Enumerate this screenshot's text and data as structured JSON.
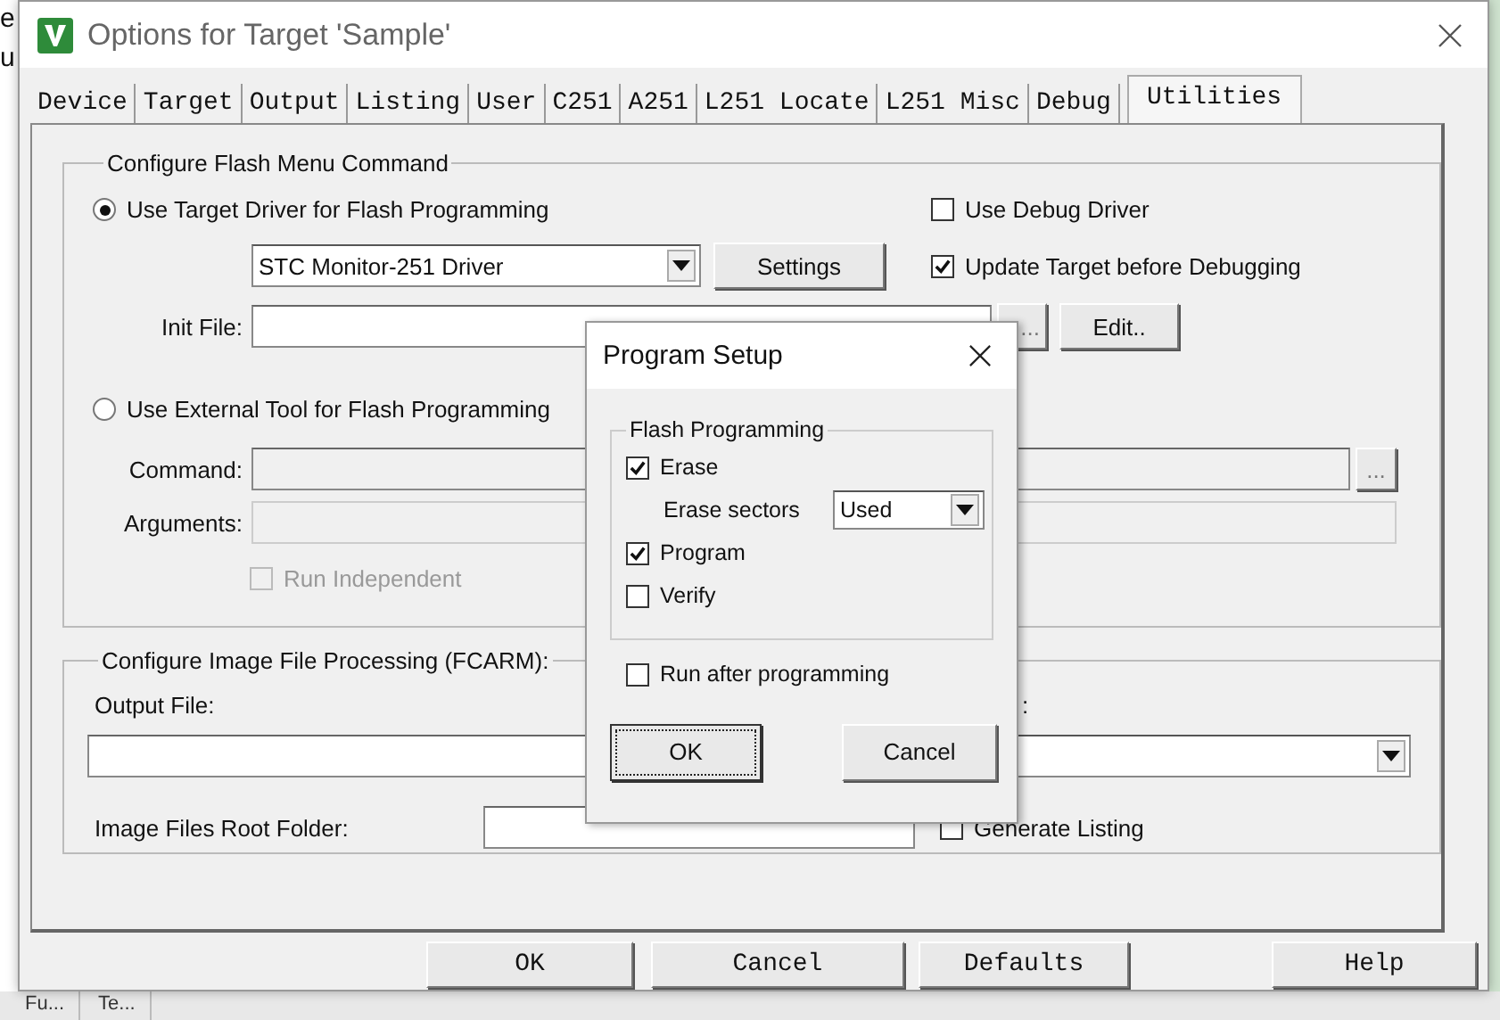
{
  "background_window": {
    "fragments": [
      "e",
      "u"
    ]
  },
  "taskbar": [
    {
      "label": "Fu..."
    },
    {
      "label": "Te..."
    }
  ],
  "window": {
    "title": "Options for Target 'Sample'"
  },
  "tabs": [
    {
      "label": "Device",
      "selected": false
    },
    {
      "label": "Target",
      "selected": false
    },
    {
      "label": "Output",
      "selected": false
    },
    {
      "label": "Listing",
      "selected": false
    },
    {
      "label": "User",
      "selected": false
    },
    {
      "label": "C251",
      "selected": false
    },
    {
      "label": "A251",
      "selected": false
    },
    {
      "label": "L251 Locate",
      "selected": false
    },
    {
      "label": "L251 Misc",
      "selected": false
    },
    {
      "label": "Debug",
      "selected": false
    },
    {
      "label": "Utilities",
      "selected": true
    }
  ],
  "flash_menu_group": {
    "title": "Configure Flash Menu Command",
    "target_driver_option": {
      "label": "Use Target Driver for Flash Programming",
      "selected": true
    },
    "use_debug_driver": {
      "label": "Use Debug Driver",
      "checked": false
    },
    "driver_select": {
      "value": "STC Monitor-251 Driver"
    },
    "settings_button": "Settings",
    "update_target": {
      "label": "Update Target before Debugging",
      "checked": true
    },
    "init_file": {
      "label": "Init File:"
    },
    "browse_button": "...",
    "edit_button": "Edit..",
    "external_tool_option": {
      "label": "Use External Tool for Flash Programming",
      "selected": false
    },
    "command": {
      "label": "Command:"
    },
    "command_browse_button": "...",
    "arguments": {
      "label": "Arguments:"
    },
    "run_independent": {
      "label": "Run Independent",
      "checked": false,
      "disabled": true
    }
  },
  "image_group": {
    "title": "Configure Image File Processing (FCARM):",
    "output_file": {
      "label": "Output File:"
    },
    "label_2": ":",
    "root_folder": {
      "label": "Image Files Root Folder:"
    },
    "generate_listing": {
      "label": "Generate Listing",
      "checked": false
    }
  },
  "buttons": [
    "OK",
    "Cancel",
    "Defaults",
    "Help"
  ],
  "program_setup": {
    "title": "Program Setup",
    "group_title": "Flash Programming",
    "erase": {
      "label": "Erase",
      "checked": true
    },
    "erase_sectors": {
      "label": "Erase sectors",
      "value": "Used"
    },
    "program": {
      "label": "Program",
      "checked": true
    },
    "verify": {
      "label": "Verify",
      "checked": false
    },
    "run_after": {
      "label": "Run after programming",
      "checked": false
    },
    "buttons": [
      "OK",
      "Cancel"
    ]
  }
}
